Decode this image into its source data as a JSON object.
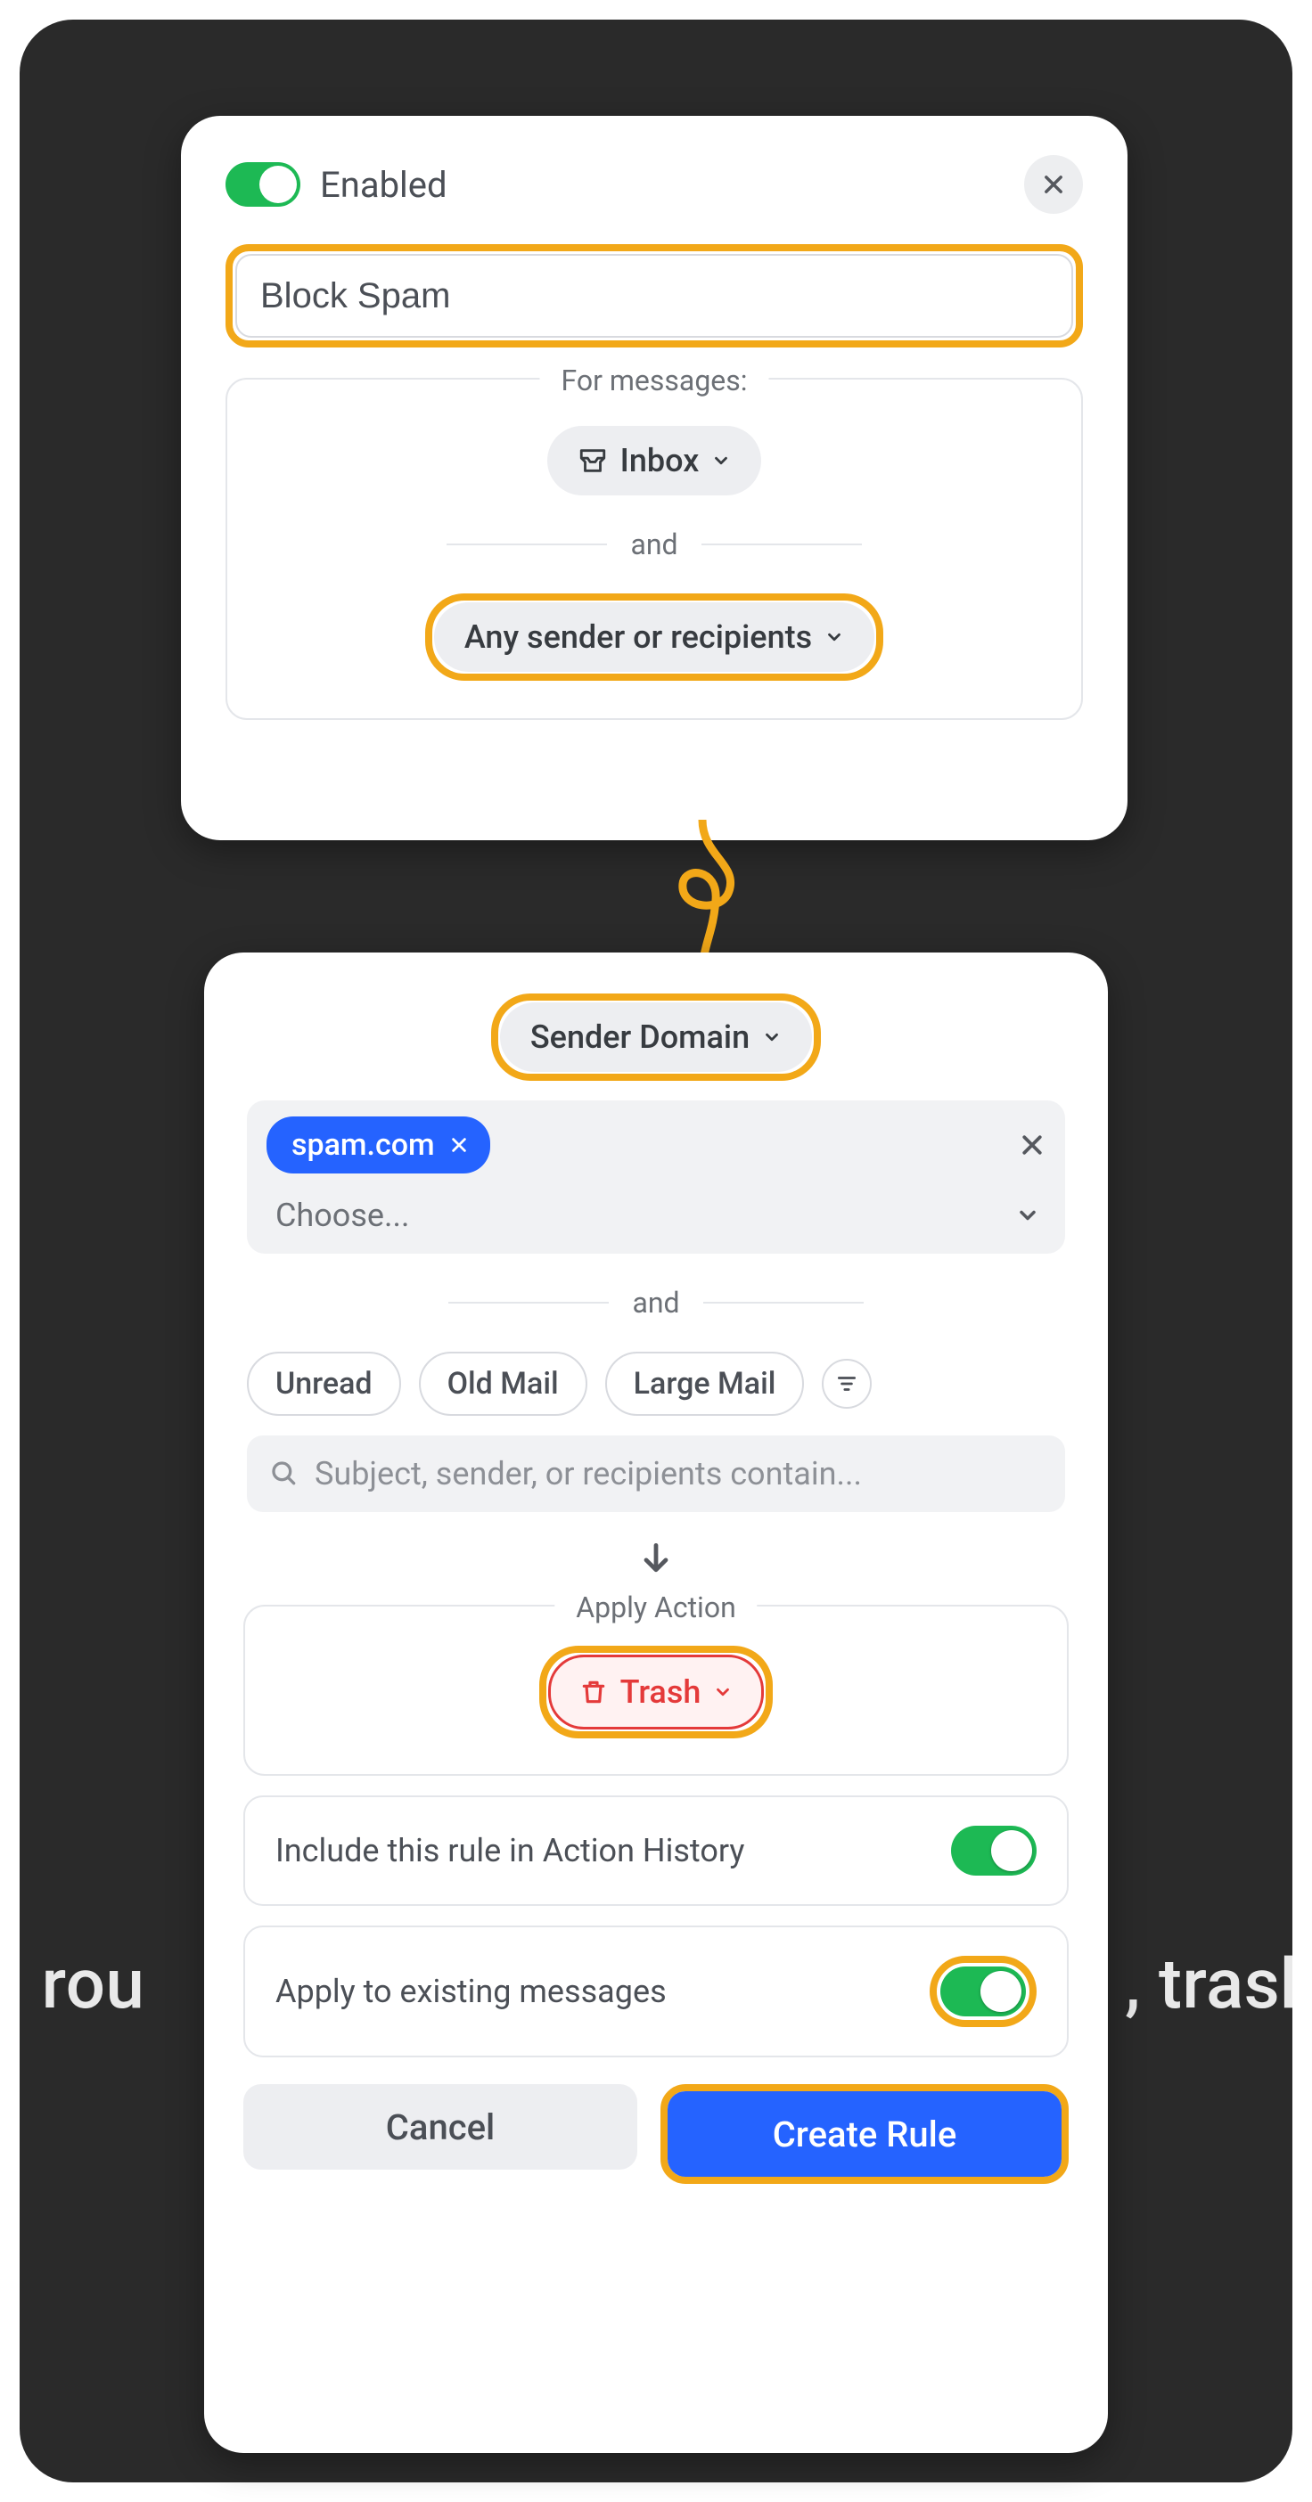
{
  "header": {
    "enabled_label": "Enabled"
  },
  "rule_name": "Block Spam",
  "messages_section": {
    "label": "For messages:",
    "mailbox": "Inbox",
    "and": "and",
    "sender_filter": "Any sender or recipients"
  },
  "domain_section": {
    "dropdown_label": "Sender Domain",
    "chip": "spam.com",
    "choose_placeholder": "Choose...",
    "and": "and",
    "filter_chips": [
      "Unread",
      "Old Mail",
      "Large Mail"
    ],
    "search_placeholder": "Subject, sender, or recipients contain..."
  },
  "action_section": {
    "label": "Apply Action",
    "action": "Trash"
  },
  "options": {
    "history_label": "Include this rule in Action History",
    "apply_existing_label": "Apply to existing messages"
  },
  "footer": {
    "cancel": "Cancel",
    "create": "Create Rule"
  },
  "bg_text_left": "g rou",
  "bg_text_right": ", trash"
}
